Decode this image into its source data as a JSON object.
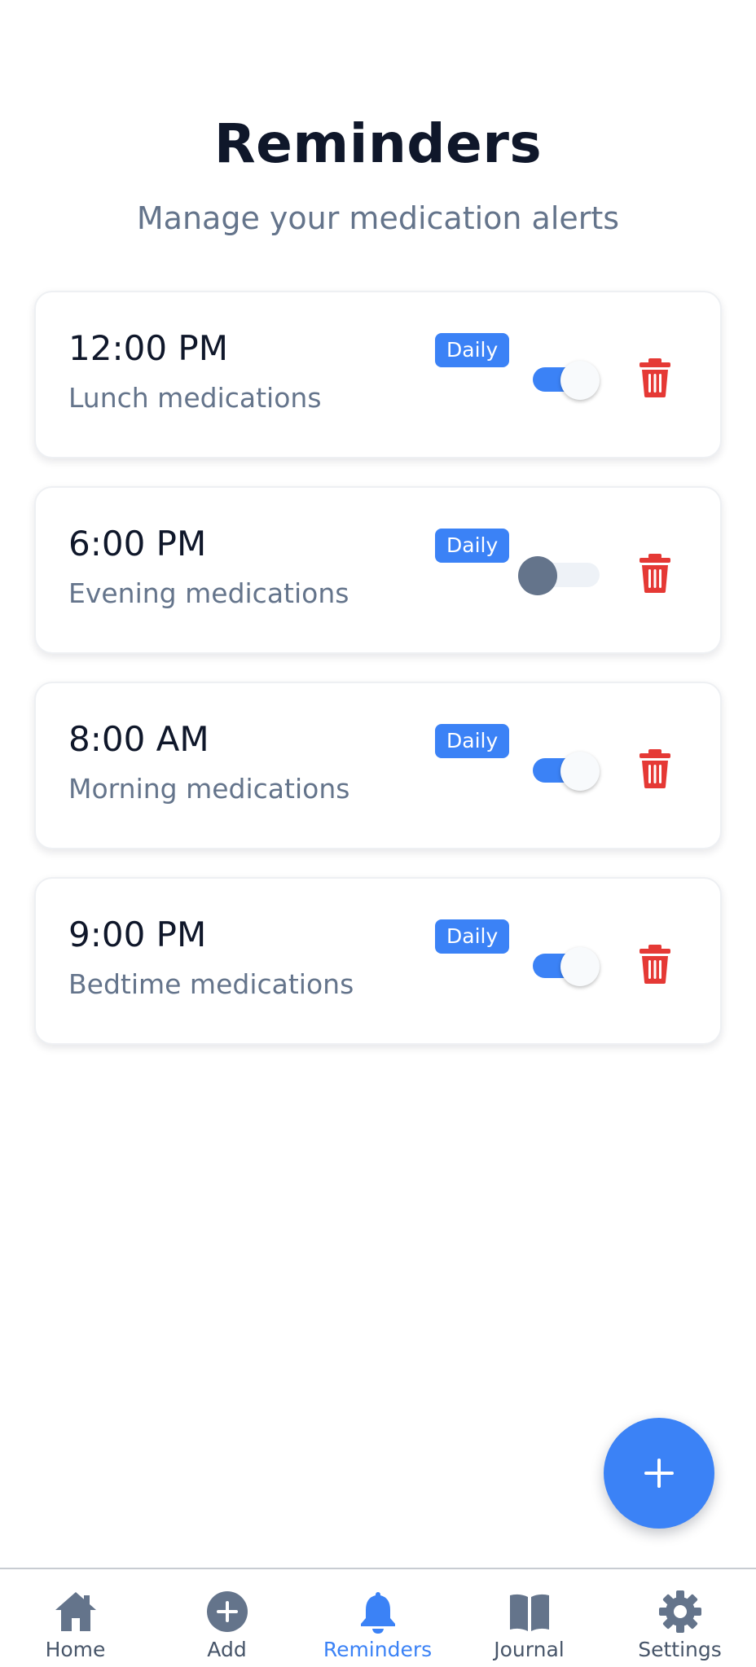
{
  "header": {
    "title": "Reminders",
    "subtitle": "Manage your medication alerts"
  },
  "reminders": [
    {
      "time": "12:00 PM",
      "label": "Lunch medications",
      "frequency": "Daily",
      "enabled": true
    },
    {
      "time": "6:00 PM",
      "label": "Evening medications",
      "frequency": "Daily",
      "enabled": false
    },
    {
      "time": "8:00 AM",
      "label": "Morning medications",
      "frequency": "Daily",
      "enabled": true
    },
    {
      "time": "9:00 PM",
      "label": "Bedtime medications",
      "frequency": "Daily",
      "enabled": true
    }
  ],
  "fab": {
    "icon": "plus-icon"
  },
  "tabbar": {
    "items": [
      {
        "label": "Home",
        "icon": "home-icon",
        "active": false
      },
      {
        "label": "Add",
        "icon": "add-circle-icon",
        "active": false
      },
      {
        "label": "Reminders",
        "icon": "bell-icon",
        "active": true
      },
      {
        "label": "Journal",
        "icon": "book-icon",
        "active": false
      },
      {
        "label": "Settings",
        "icon": "gear-icon",
        "active": false
      }
    ]
  },
  "colors": {
    "accent": "#3b82f6",
    "danger": "#e53935",
    "text_primary": "#0f172a",
    "text_secondary": "#64748b",
    "toggle_off_thumb": "#64748b"
  }
}
